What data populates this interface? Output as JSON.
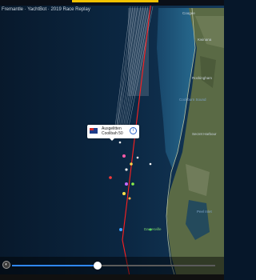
{
  "window": {
    "title": "Fremantle · YachtBot · 2019 Race Replay"
  },
  "map_labels": [
    {
      "id": "top-right-1",
      "text": "Coogee"
    },
    {
      "id": "right-2",
      "text": "Kwinana"
    },
    {
      "id": "right-3",
      "text": "Rockingham"
    },
    {
      "id": "water-1",
      "text": "Cockburn Sound"
    },
    {
      "id": "right-4",
      "text": "Secret Harbour"
    },
    {
      "id": "water-2",
      "text": "Peel Inlet"
    },
    {
      "id": "green-1",
      "text": "Dawesville"
    }
  ],
  "popup": {
    "line1": "Ausgelitten",
    "line2": "Coolibah 50",
    "info_symbol": "i"
  },
  "playback": {
    "speed_symbol": "◐",
    "progress": 0.42,
    "accent_color": "#2f88ff"
  },
  "colors": {
    "ocean": "#0b2640",
    "land": "#5b6a45",
    "course_line": "#ff2020"
  }
}
